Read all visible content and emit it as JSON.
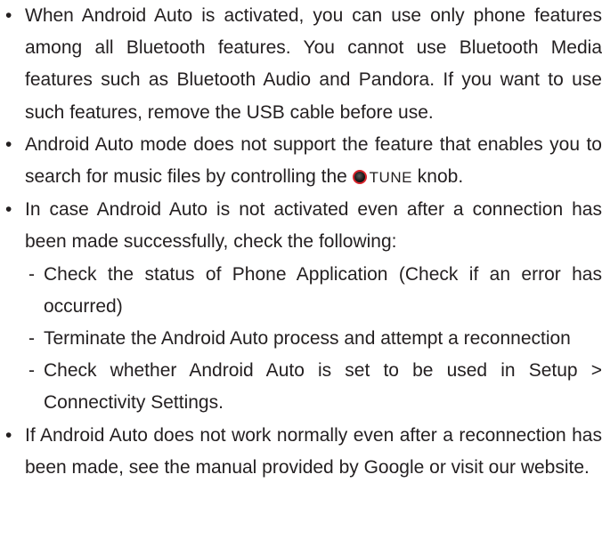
{
  "bullet_symbol": "•",
  "sub_symbol": "-",
  "item1": {
    "text": "When Android Auto is activated, you can use only phone features among all Bluetooth features. You cannot use Bluetooth Media features such as Bluetooth Audio and Pandora. If you want to use such features, remove the USB cable before use."
  },
  "item2": {
    "text_before": "Android Auto mode does not support the feature that enables you to search for music files by controlling the",
    "icon": "knob-icon",
    "knob_label": "TUNE",
    "text_after": "knob."
  },
  "item3": {
    "text": "In case Android Auto is not activated even after a connection has been made successfully, check the following:",
    "subitems": [
      "Check the status of Phone Application (Check if an error has occurred)",
      "Terminate the Android Auto process and attempt a reconnection",
      "Check whether Android Auto is set to be used in Setup > Connectivity Settings."
    ]
  },
  "item4": {
    "text": "If Android Auto does not work normally even after a reconnection has been made, see the manual provided by Google or visit our website."
  }
}
